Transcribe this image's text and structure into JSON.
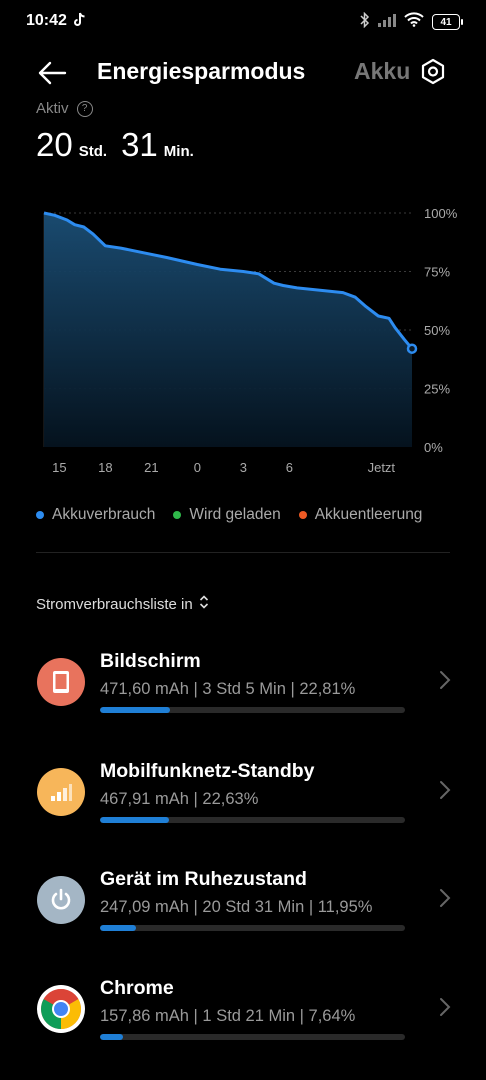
{
  "status_bar": {
    "time": "10:42",
    "battery_level": "41",
    "icons": [
      "tiktok-icon",
      "bluetooth-icon",
      "signal-icon",
      "wifi-icon",
      "battery-icon"
    ]
  },
  "header": {
    "title": "Energiesparmodus",
    "next_tab": "Akku",
    "icons": [
      "back-arrow-icon",
      "settings-icon"
    ]
  },
  "summary": {
    "label": "Aktiv",
    "hours": "20",
    "hours_unit": "Std.",
    "minutes": "31",
    "minutes_unit": "Min."
  },
  "chart_data": {
    "type": "area",
    "x_ticks": [
      "15",
      "18",
      "21",
      "0",
      "3",
      "6",
      "Jetzt"
    ],
    "y_ticks": [
      "100%",
      "75%",
      "50%",
      "25%",
      "0%"
    ],
    "ylim": [
      0,
      100
    ],
    "series": [
      {
        "name": "Akkuverbrauch",
        "color": "#2d8cf0",
        "x": [
          0,
          0.7,
          1.5,
          2.0,
          2.6,
          3.2,
          4.0,
          5.0,
          6.5,
          8.0,
          10.0,
          11.5,
          13.0,
          14.0,
          15.0,
          15.6,
          16.5,
          18.0,
          19.5,
          20.3,
          21.0,
          21.8,
          22.5,
          22.9,
          23.5,
          24.0
        ],
        "values": [
          100,
          99,
          97,
          95,
          94,
          91,
          86,
          85,
          83,
          81,
          78,
          76,
          75,
          74,
          70,
          69,
          68,
          67,
          66,
          64,
          60,
          56,
          55,
          51,
          46,
          42
        ]
      }
    ],
    "legend": [
      {
        "label": "Akkuverbrauch",
        "color": "#2d8cf0"
      },
      {
        "label": "Wird geladen",
        "color": "#2fb84a"
      },
      {
        "label": "Akkuentleerung",
        "color": "#ee5a24"
      }
    ],
    "legend_position": "bottom",
    "grid": true
  },
  "list": {
    "header": "Stromverbrauchsliste in",
    "items": [
      {
        "title": "Bildschirm",
        "subtitle": "471,60 mAh | 3 Std 5 Min  | 22,81%",
        "percent": 22.81,
        "icon": "screen-icon",
        "icon_bg": "#e8735d"
      },
      {
        "title": "Mobilfunknetz-Standby",
        "subtitle": "467,91 mAh | 22,63%",
        "percent": 22.63,
        "icon": "signal-icon",
        "icon_bg": "#f7b65a"
      },
      {
        "title": "Gerät im Ruhezustand",
        "subtitle": "247,09 mAh | 20 Std 31 Min  | 11,95%",
        "percent": 11.95,
        "icon": "power-icon",
        "icon_bg": "#a4b6c5"
      },
      {
        "title": "Chrome",
        "subtitle": "157,86 mAh | 1 Std 21 Min  | 7,64%",
        "percent": 7.64,
        "icon": "chrome-icon",
        "icon_bg": "#ffffff"
      }
    ]
  }
}
